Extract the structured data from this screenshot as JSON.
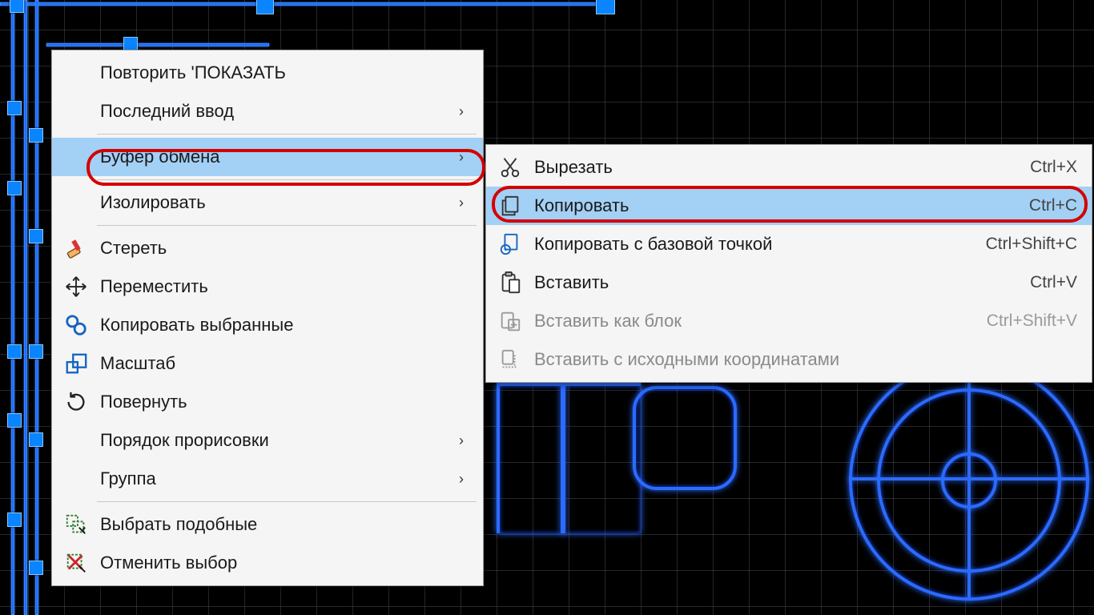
{
  "context_menu": {
    "items": {
      "repeat": {
        "label": "Повторить 'ПОКАЗАТЬ"
      },
      "recent_input": {
        "label": "Последний ввод"
      },
      "clipboard": {
        "label": "Буфер обмена"
      },
      "isolate": {
        "label": "Изолировать"
      },
      "erase": {
        "label": "Стереть"
      },
      "move": {
        "label": "Переместить"
      },
      "copy_selected": {
        "label": "Копировать выбранные"
      },
      "scale": {
        "label": "Масштаб"
      },
      "rotate": {
        "label": "Повернуть"
      },
      "draw_order": {
        "label": "Порядок прорисовки"
      },
      "group": {
        "label": "Группа"
      },
      "select_similar": {
        "label": "Выбрать подобные"
      },
      "deselect": {
        "label": "Отменить выбор"
      }
    }
  },
  "submenu_clipboard": {
    "items": {
      "cut": {
        "label": "Вырезать",
        "shortcut": "Ctrl+X"
      },
      "copy": {
        "label": "Копировать",
        "shortcut": "Ctrl+C"
      },
      "copy_base": {
        "label": "Копировать с базовой точкой",
        "shortcut": "Ctrl+Shift+C"
      },
      "paste": {
        "label": "Вставить",
        "shortcut": "Ctrl+V"
      },
      "paste_block": {
        "label": "Вставить как блок",
        "shortcut": "Ctrl+Shift+V"
      },
      "paste_original": {
        "label": "Вставить с исходными координатами"
      }
    }
  },
  "arrow_glyph": "›"
}
